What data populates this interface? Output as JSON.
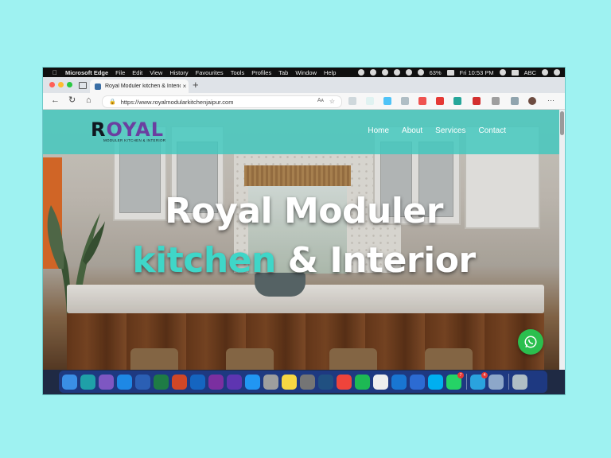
{
  "menubar": {
    "app_name": "Microsoft Edge",
    "menus": [
      "File",
      "Edit",
      "View",
      "History",
      "Favourites",
      "Tools",
      "Profiles",
      "Tab",
      "Window",
      "Help"
    ],
    "battery": "63%",
    "clock": "Fri 10:53 PM",
    "input_source": "ABC"
  },
  "browser": {
    "tab_title": "Royal Moduler kitchen & Interior",
    "tab_close": "×",
    "new_tab": "+",
    "url": "https://www.royalmodularkitchenjaipur.com",
    "back": "←",
    "refresh": "↻",
    "home": "⌂",
    "more": "···",
    "read_aloud": "Aᴀ"
  },
  "site": {
    "logo_letter": "R",
    "logo_rest": "OYAL",
    "logo_tagline": "MODULER KITCHEN & INTERIOR",
    "nav": [
      "Home",
      "About",
      "Services",
      "Contact"
    ],
    "hero_line1": "Royal Moduler",
    "hero_accent": "kitchen",
    "hero_rest": " & Interior"
  },
  "colors": {
    "accent": "#3fd6c8",
    "header_teal": "#40c8be",
    "whatsapp": "#2bbf4e",
    "dock": "#1e3c8c",
    "desktop_bg": "#9ef2f1"
  },
  "dock": {
    "apps": [
      {
        "name": "finder",
        "color": "#3a8ee6"
      },
      {
        "name": "edge",
        "color": "#1fa0a8"
      },
      {
        "name": "visual-studio",
        "color": "#7e57c2"
      },
      {
        "name": "vscode",
        "color": "#1e88e5"
      },
      {
        "name": "word",
        "color": "#2b5fb4"
      },
      {
        "name": "excel",
        "color": "#1e7b45"
      },
      {
        "name": "powerpoint",
        "color": "#d24726"
      },
      {
        "name": "outlook",
        "color": "#1565c0"
      },
      {
        "name": "onenote",
        "color": "#7b2fa0"
      },
      {
        "name": "siri",
        "color": "#5e35b1"
      },
      {
        "name": "app-store",
        "color": "#2196f3"
      },
      {
        "name": "launchpad",
        "color": "#9e9e9e"
      },
      {
        "name": "stickies",
        "color": "#f6d743"
      },
      {
        "name": "system-preferences",
        "color": "#757575"
      },
      {
        "name": "sourcetree",
        "color": "#205081"
      },
      {
        "name": "anydesk",
        "color": "#ef443b"
      },
      {
        "name": "spotify",
        "color": "#1db954"
      },
      {
        "name": "textedit",
        "color": "#eeeeee"
      },
      {
        "name": "xcode",
        "color": "#1976d2"
      },
      {
        "name": "simulator",
        "color": "#2c6bd2"
      },
      {
        "name": "skype",
        "color": "#00aff0"
      },
      {
        "name": "whatsapp",
        "color": "#25d366",
        "badge": "7"
      },
      {
        "name": "telegram",
        "color": "#2aa3de",
        "badge": "4"
      },
      {
        "name": "preview",
        "color": "#8da7c9"
      },
      {
        "name": "trash",
        "color": "#b0bec5"
      }
    ]
  }
}
